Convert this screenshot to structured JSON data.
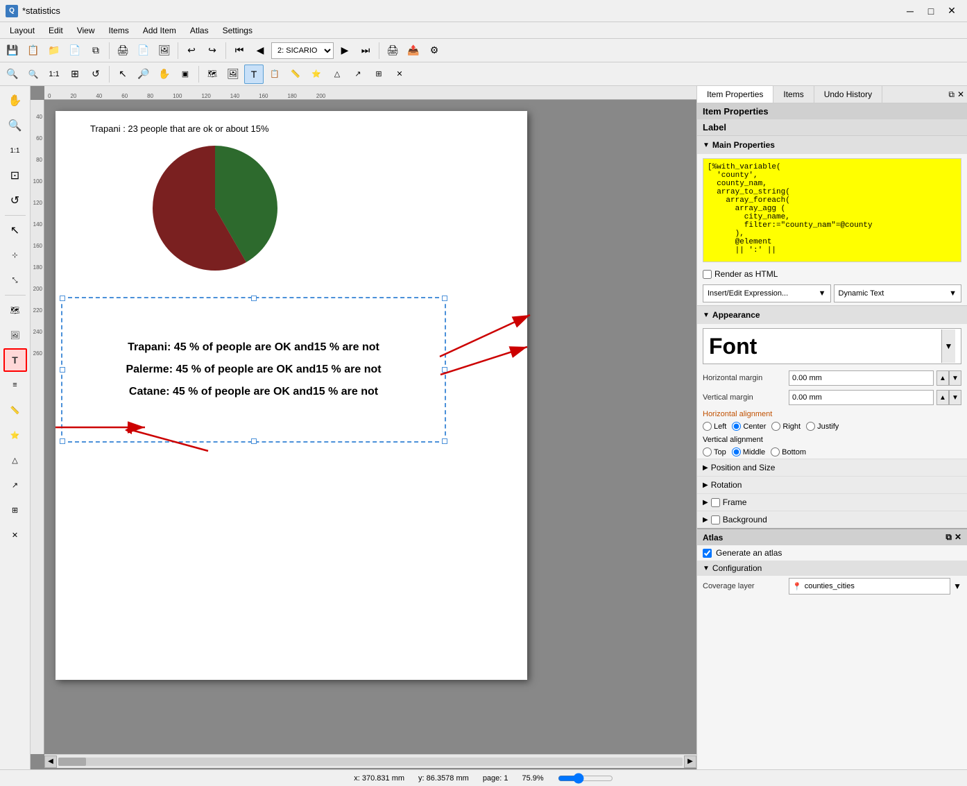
{
  "titlebar": {
    "title": "*statistics",
    "icon": "Q",
    "controls": [
      "minimize",
      "maximize",
      "close"
    ]
  },
  "menubar": {
    "items": [
      "Layout",
      "Edit",
      "View",
      "Items",
      "Add Item",
      "Atlas",
      "Settings"
    ]
  },
  "toolbar1": {
    "buttons": [
      "save",
      "save-as",
      "open",
      "new-layout",
      "open-layout",
      "duplicate",
      "print",
      "export-pdf",
      "export-img",
      "undo",
      "redo"
    ],
    "atlas_prev": "◀◀",
    "atlas_nav_prev": "◀",
    "atlas_combo": "2: SICARIO",
    "atlas_nav_next": "▶",
    "atlas_next": "▶▶",
    "atlas_print": "🖨",
    "atlas_export": "📤"
  },
  "toolbar2": {
    "buttons": [
      "zoom-in",
      "zoom-out",
      "zoom-100",
      "zoom-layer",
      "zoom-refresh",
      "select-move",
      "zoom-tool",
      "pan-tool",
      "select-features",
      "add-map",
      "add-picture",
      "add-label",
      "add-legend",
      "add-scalebar",
      "add-shape",
      "add-arrow",
      "add-table",
      "close-tool"
    ]
  },
  "canvas": {
    "chart_title": "Trapani : 23 people that are ok or about 15%",
    "label_lines": [
      "Trapani: 45 % of people are OK and15 % are not",
      "Palerme: 45 % of people are OK and15 % are not",
      "Catane: 45 % of people are OK and15 % are not"
    ]
  },
  "right_panel": {
    "tabs": [
      "Item Properties",
      "Items",
      "Undo History"
    ],
    "active_tab": "Item Properties",
    "panel_title": "Item Properties",
    "label_title": "Label",
    "sections": {
      "main_properties": {
        "title": "Main Properties",
        "expression": "[%with_variable(\n  'county',\n  county_nam,\n  array_to_string(\n    array_foreach(\n      array_agg (\n        city_name,\n        filter:=\"county_nam\"=@county\n      ),\n      @element\n      || ':' ||",
        "render_html": false,
        "insert_btn": "Insert/Edit Expression...",
        "dynamic_btn": "Dynamic Text"
      },
      "appearance": {
        "title": "Appearance",
        "font": "Font",
        "h_margin": "0.00 mm",
        "v_margin": "0.00 mm",
        "h_alignment": {
          "label": "Horizontal alignment",
          "options": [
            "Left",
            "Center",
            "Right",
            "Justify"
          ],
          "selected": "Center"
        },
        "v_alignment": {
          "label": "Vertical alignment",
          "options": [
            "Top",
            "Middle",
            "Bottom"
          ],
          "selected": "Middle"
        }
      },
      "position_size": {
        "title": "Position and Size",
        "collapsed": true
      },
      "rotation": {
        "title": "Rotation",
        "collapsed": true
      },
      "frame": {
        "title": "Frame",
        "collapsed": true,
        "checked": false
      },
      "background": {
        "title": "Background",
        "collapsed": true
      }
    },
    "atlas": {
      "title": "Atlas",
      "generate": true,
      "generate_label": "Generate an atlas",
      "config_title": "Configuration",
      "coverage_layer_label": "Coverage layer",
      "coverage_layer": "counties_cities",
      "coverage_icon": "📍"
    }
  },
  "statusbar": {
    "x": "x: 370.831 mm",
    "y": "y: 86.3578 mm",
    "page": "page: 1",
    "zoom": "75.9%"
  }
}
